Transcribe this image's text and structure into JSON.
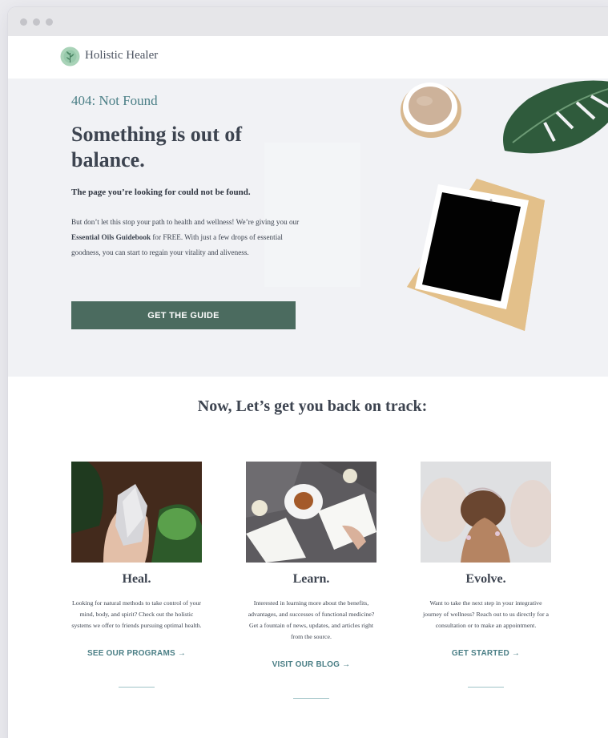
{
  "brand": {
    "name": "Holistic Healer",
    "logo_icon": "leaf-sprig-icon",
    "accent": "#4b6b5f",
    "teal": "#4b7f86"
  },
  "hero": {
    "error_code": "404: Not Found",
    "headline": "Something is out of balance.",
    "subheading": "The page you’re looking for could not be found.",
    "body_intro": "But don’t let this stop your path to health and wellness! We’re giving you our ",
    "body_bold": "Essential Oils Guidebook",
    "body_outro": " for FREE. With just a few drops of essential goodness, you can start to regain your vitality and aliveness.",
    "cta_label": "GET THE GUIDE"
  },
  "section": {
    "title": "Now, Let’s get you back on track:"
  },
  "cards": [
    {
      "title": "Heal.",
      "text": "Looking for natural methods to take control of your mind, body, and spirit? Check out the holistic systems we offer to friends pursuing optimal health.",
      "link": "SEE OUR PROGRAMS →"
    },
    {
      "title": "Learn.",
      "text": "Interested in learning more about the benefits, advantages, and successes of functional medicine? Get a fountain of news, updates, and articles right from the source.",
      "link": "VISIT OUR BLOG →"
    },
    {
      "title": "Evolve.",
      "text": "Want to take the next step in your integrative journey of wellness? Reach out to us directly for a consultation or to make an appointment.",
      "link": "GET STARTED →"
    }
  ]
}
